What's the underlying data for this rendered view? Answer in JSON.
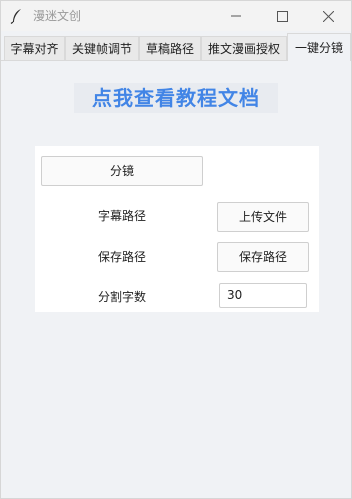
{
  "window": {
    "title": "漫迷文创"
  },
  "tabs": [
    {
      "label": "字幕对齐"
    },
    {
      "label": "关键帧调节"
    },
    {
      "label": "草稿路径"
    },
    {
      "label": "推文漫画授权"
    },
    {
      "label": "一键分镜",
      "active": true
    }
  ],
  "main": {
    "doc_link": "点我查看教程文档",
    "split_button": "分镜",
    "subtitle_path_label": "字幕路径",
    "upload_button": "上传文件",
    "save_path_label": "保存路径",
    "save_path_button": "保存路径",
    "split_count_label": "分割字数",
    "split_count_value": "30"
  },
  "colors": {
    "accent": "#4285e6",
    "panel": "#ffffff",
    "background": "#f0f2f5"
  },
  "icons": [
    "feather-icon",
    "minimize-icon",
    "maximize-icon",
    "close-icon"
  ]
}
